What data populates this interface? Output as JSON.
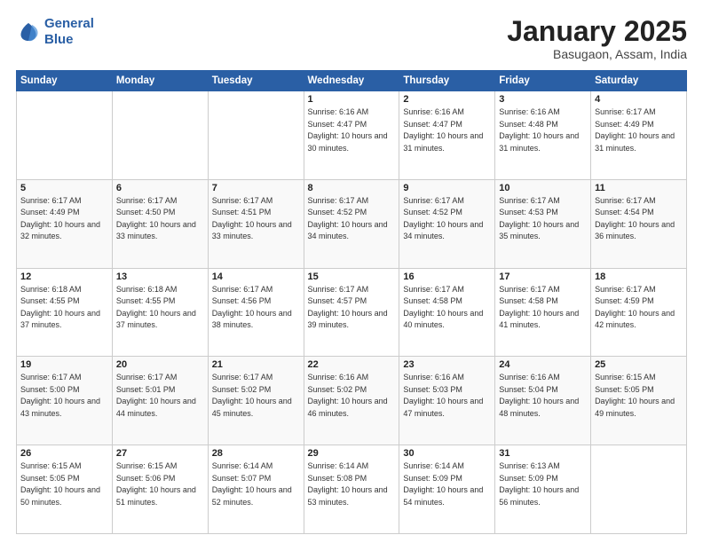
{
  "header": {
    "logo_line1": "General",
    "logo_line2": "Blue",
    "title": "January 2025",
    "subtitle": "Basugaon, Assam, India"
  },
  "weekdays": [
    "Sunday",
    "Monday",
    "Tuesday",
    "Wednesday",
    "Thursday",
    "Friday",
    "Saturday"
  ],
  "weeks": [
    [
      {
        "day": "",
        "sunrise": "",
        "sunset": "",
        "daylight": ""
      },
      {
        "day": "",
        "sunrise": "",
        "sunset": "",
        "daylight": ""
      },
      {
        "day": "",
        "sunrise": "",
        "sunset": "",
        "daylight": ""
      },
      {
        "day": "1",
        "sunrise": "Sunrise: 6:16 AM",
        "sunset": "Sunset: 4:47 PM",
        "daylight": "Daylight: 10 hours and 30 minutes."
      },
      {
        "day": "2",
        "sunrise": "Sunrise: 6:16 AM",
        "sunset": "Sunset: 4:47 PM",
        "daylight": "Daylight: 10 hours and 31 minutes."
      },
      {
        "day": "3",
        "sunrise": "Sunrise: 6:16 AM",
        "sunset": "Sunset: 4:48 PM",
        "daylight": "Daylight: 10 hours and 31 minutes."
      },
      {
        "day": "4",
        "sunrise": "Sunrise: 6:17 AM",
        "sunset": "Sunset: 4:49 PM",
        "daylight": "Daylight: 10 hours and 31 minutes."
      }
    ],
    [
      {
        "day": "5",
        "sunrise": "Sunrise: 6:17 AM",
        "sunset": "Sunset: 4:49 PM",
        "daylight": "Daylight: 10 hours and 32 minutes."
      },
      {
        "day": "6",
        "sunrise": "Sunrise: 6:17 AM",
        "sunset": "Sunset: 4:50 PM",
        "daylight": "Daylight: 10 hours and 33 minutes."
      },
      {
        "day": "7",
        "sunrise": "Sunrise: 6:17 AM",
        "sunset": "Sunset: 4:51 PM",
        "daylight": "Daylight: 10 hours and 33 minutes."
      },
      {
        "day": "8",
        "sunrise": "Sunrise: 6:17 AM",
        "sunset": "Sunset: 4:52 PM",
        "daylight": "Daylight: 10 hours and 34 minutes."
      },
      {
        "day": "9",
        "sunrise": "Sunrise: 6:17 AM",
        "sunset": "Sunset: 4:52 PM",
        "daylight": "Daylight: 10 hours and 34 minutes."
      },
      {
        "day": "10",
        "sunrise": "Sunrise: 6:17 AM",
        "sunset": "Sunset: 4:53 PM",
        "daylight": "Daylight: 10 hours and 35 minutes."
      },
      {
        "day": "11",
        "sunrise": "Sunrise: 6:17 AM",
        "sunset": "Sunset: 4:54 PM",
        "daylight": "Daylight: 10 hours and 36 minutes."
      }
    ],
    [
      {
        "day": "12",
        "sunrise": "Sunrise: 6:18 AM",
        "sunset": "Sunset: 4:55 PM",
        "daylight": "Daylight: 10 hours and 37 minutes."
      },
      {
        "day": "13",
        "sunrise": "Sunrise: 6:18 AM",
        "sunset": "Sunset: 4:55 PM",
        "daylight": "Daylight: 10 hours and 37 minutes."
      },
      {
        "day": "14",
        "sunrise": "Sunrise: 6:17 AM",
        "sunset": "Sunset: 4:56 PM",
        "daylight": "Daylight: 10 hours and 38 minutes."
      },
      {
        "day": "15",
        "sunrise": "Sunrise: 6:17 AM",
        "sunset": "Sunset: 4:57 PM",
        "daylight": "Daylight: 10 hours and 39 minutes."
      },
      {
        "day": "16",
        "sunrise": "Sunrise: 6:17 AM",
        "sunset": "Sunset: 4:58 PM",
        "daylight": "Daylight: 10 hours and 40 minutes."
      },
      {
        "day": "17",
        "sunrise": "Sunrise: 6:17 AM",
        "sunset": "Sunset: 4:58 PM",
        "daylight": "Daylight: 10 hours and 41 minutes."
      },
      {
        "day": "18",
        "sunrise": "Sunrise: 6:17 AM",
        "sunset": "Sunset: 4:59 PM",
        "daylight": "Daylight: 10 hours and 42 minutes."
      }
    ],
    [
      {
        "day": "19",
        "sunrise": "Sunrise: 6:17 AM",
        "sunset": "Sunset: 5:00 PM",
        "daylight": "Daylight: 10 hours and 43 minutes."
      },
      {
        "day": "20",
        "sunrise": "Sunrise: 6:17 AM",
        "sunset": "Sunset: 5:01 PM",
        "daylight": "Daylight: 10 hours and 44 minutes."
      },
      {
        "day": "21",
        "sunrise": "Sunrise: 6:17 AM",
        "sunset": "Sunset: 5:02 PM",
        "daylight": "Daylight: 10 hours and 45 minutes."
      },
      {
        "day": "22",
        "sunrise": "Sunrise: 6:16 AM",
        "sunset": "Sunset: 5:02 PM",
        "daylight": "Daylight: 10 hours and 46 minutes."
      },
      {
        "day": "23",
        "sunrise": "Sunrise: 6:16 AM",
        "sunset": "Sunset: 5:03 PM",
        "daylight": "Daylight: 10 hours and 47 minutes."
      },
      {
        "day": "24",
        "sunrise": "Sunrise: 6:16 AM",
        "sunset": "Sunset: 5:04 PM",
        "daylight": "Daylight: 10 hours and 48 minutes."
      },
      {
        "day": "25",
        "sunrise": "Sunrise: 6:15 AM",
        "sunset": "Sunset: 5:05 PM",
        "daylight": "Daylight: 10 hours and 49 minutes."
      }
    ],
    [
      {
        "day": "26",
        "sunrise": "Sunrise: 6:15 AM",
        "sunset": "Sunset: 5:05 PM",
        "daylight": "Daylight: 10 hours and 50 minutes."
      },
      {
        "day": "27",
        "sunrise": "Sunrise: 6:15 AM",
        "sunset": "Sunset: 5:06 PM",
        "daylight": "Daylight: 10 hours and 51 minutes."
      },
      {
        "day": "28",
        "sunrise": "Sunrise: 6:14 AM",
        "sunset": "Sunset: 5:07 PM",
        "daylight": "Daylight: 10 hours and 52 minutes."
      },
      {
        "day": "29",
        "sunrise": "Sunrise: 6:14 AM",
        "sunset": "Sunset: 5:08 PM",
        "daylight": "Daylight: 10 hours and 53 minutes."
      },
      {
        "day": "30",
        "sunrise": "Sunrise: 6:14 AM",
        "sunset": "Sunset: 5:09 PM",
        "daylight": "Daylight: 10 hours and 54 minutes."
      },
      {
        "day": "31",
        "sunrise": "Sunrise: 6:13 AM",
        "sunset": "Sunset: 5:09 PM",
        "daylight": "Daylight: 10 hours and 56 minutes."
      },
      {
        "day": "",
        "sunrise": "",
        "sunset": "",
        "daylight": ""
      }
    ]
  ]
}
